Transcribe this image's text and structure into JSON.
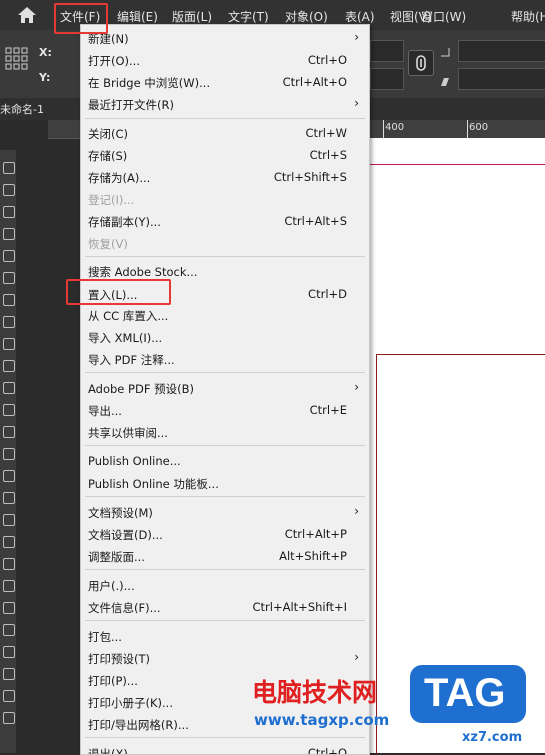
{
  "menubar": {
    "items": [
      "文件(F)",
      "编辑(E)",
      "版面(L)",
      "文字(T)",
      "对象(O)",
      "表(A)",
      "视图(V)",
      "窗口(W)",
      "帮助(H)"
    ]
  },
  "control": {
    "x_label": "X:",
    "y_label": "Y:",
    "link_icon": "chain-link-icon"
  },
  "document_tab": {
    "label": "未命名-1"
  },
  "ruler": {
    "ticks": [
      "400",
      "600"
    ]
  },
  "file_menu": {
    "items": [
      {
        "label": "新建(N)",
        "shortcut": "",
        "submenu": true,
        "disabled": false
      },
      {
        "label": "打开(O)...",
        "shortcut": "Ctrl+O",
        "submenu": false,
        "disabled": false
      },
      {
        "label": "在 Bridge 中浏览(W)...",
        "shortcut": "Ctrl+Alt+O",
        "submenu": false,
        "disabled": false
      },
      {
        "label": "最近打开文件(R)",
        "shortcut": "",
        "submenu": true,
        "disabled": false
      },
      {
        "label": "关闭(C)",
        "shortcut": "Ctrl+W",
        "submenu": false,
        "disabled": false
      },
      {
        "label": "存储(S)",
        "shortcut": "Ctrl+S",
        "submenu": false,
        "disabled": false
      },
      {
        "label": "存储为(A)...",
        "shortcut": "Ctrl+Shift+S",
        "submenu": false,
        "disabled": false
      },
      {
        "label": "登记(I)...",
        "shortcut": "",
        "submenu": false,
        "disabled": true
      },
      {
        "label": "存储副本(Y)...",
        "shortcut": "Ctrl+Alt+S",
        "submenu": false,
        "disabled": false
      },
      {
        "label": "恢复(V)",
        "shortcut": "",
        "submenu": false,
        "disabled": true
      },
      {
        "label": "搜索 Adobe Stock...",
        "shortcut": "",
        "submenu": false,
        "disabled": false
      },
      {
        "label": "置入(L)...",
        "shortcut": "Ctrl+D",
        "submenu": false,
        "disabled": false
      },
      {
        "label": "从 CC 库置入...",
        "shortcut": "",
        "submenu": false,
        "disabled": false
      },
      {
        "label": "导入 XML(I)...",
        "shortcut": "",
        "submenu": false,
        "disabled": false
      },
      {
        "label": "导入 PDF 注释...",
        "shortcut": "",
        "submenu": false,
        "disabled": false
      },
      {
        "label": "Adobe PDF 预设(B)",
        "shortcut": "",
        "submenu": true,
        "disabled": false
      },
      {
        "label": "导出...",
        "shortcut": "Ctrl+E",
        "submenu": false,
        "disabled": false
      },
      {
        "label": "共享以供审阅...",
        "shortcut": "",
        "submenu": false,
        "disabled": false
      },
      {
        "label": "Publish Online...",
        "shortcut": "",
        "submenu": false,
        "disabled": false
      },
      {
        "label": "Publish Online 功能板...",
        "shortcut": "",
        "submenu": false,
        "disabled": false
      },
      {
        "label": "文档预设(M)",
        "shortcut": "",
        "submenu": true,
        "disabled": false
      },
      {
        "label": "文档设置(D)...",
        "shortcut": "Ctrl+Alt+P",
        "submenu": false,
        "disabled": false
      },
      {
        "label": "调整版面...",
        "shortcut": "Alt+Shift+P",
        "submenu": false,
        "disabled": false
      },
      {
        "label": "用户(.)...",
        "shortcut": "",
        "submenu": false,
        "disabled": false
      },
      {
        "label": "文件信息(F)...",
        "shortcut": "Ctrl+Alt+Shift+I",
        "submenu": false,
        "disabled": false
      },
      {
        "label": "打包...",
        "shortcut": "",
        "submenu": false,
        "disabled": false
      },
      {
        "label": "打印预设(T)",
        "shortcut": "",
        "submenu": true,
        "disabled": false
      },
      {
        "label": "打印(P)...",
        "shortcut": "",
        "submenu": false,
        "disabled": false
      },
      {
        "label": "打印小册子(K)...",
        "shortcut": "",
        "submenu": false,
        "disabled": false
      },
      {
        "label": "打印/导出网格(R)...",
        "shortcut": "",
        "submenu": false,
        "disabled": false
      },
      {
        "label": "退出(X)",
        "shortcut": "Ctrl+Q",
        "submenu": false,
        "disabled": false
      }
    ]
  },
  "watermark": {
    "title": "电脑技术网",
    "url": "www.tagxp.com",
    "badge": "TAG",
    "site": "xz7.com"
  },
  "colors": {
    "highlight": "#e53935",
    "watermark_red": "#e02020",
    "badge_blue": "#1e6fd0"
  }
}
